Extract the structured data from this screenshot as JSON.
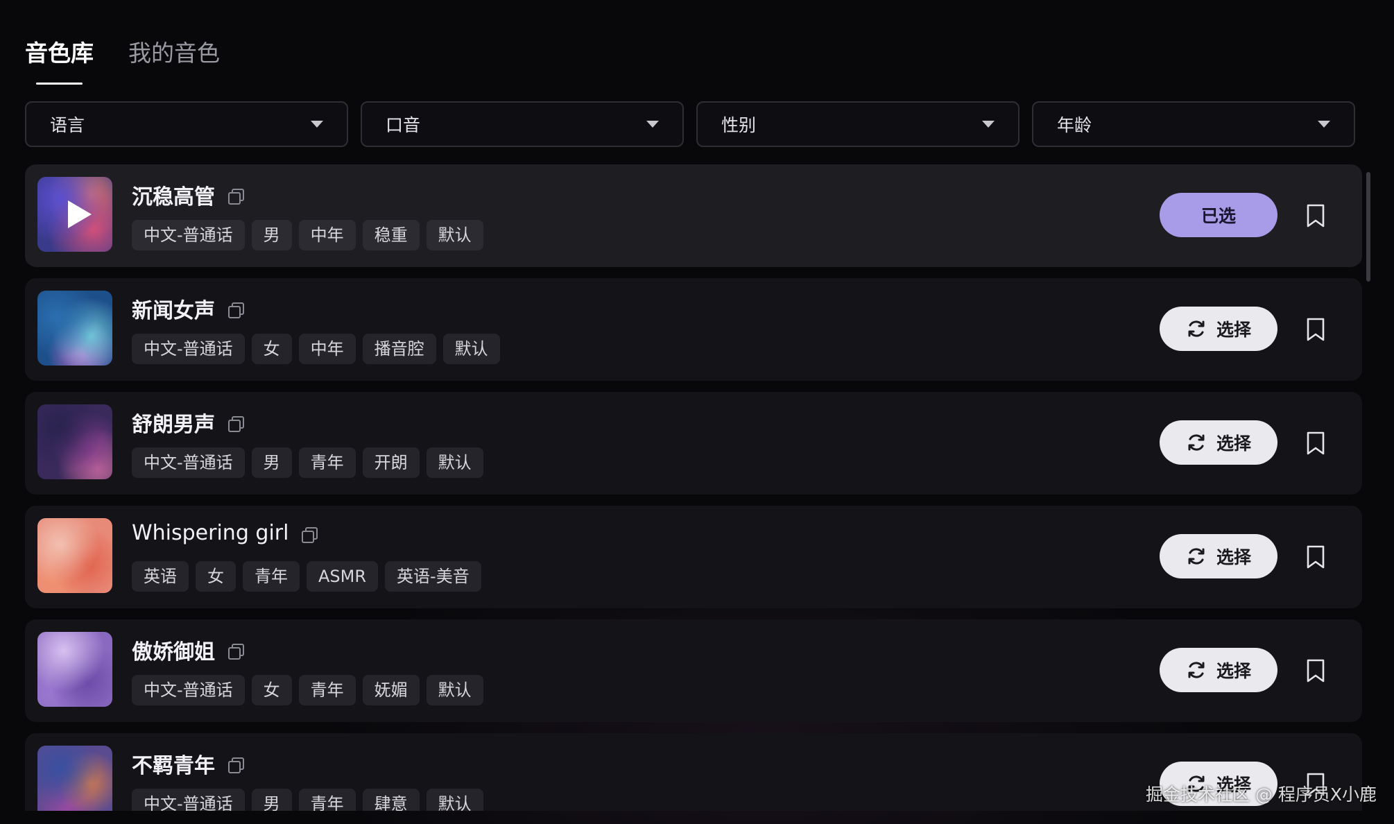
{
  "tabs": [
    {
      "label": "音色库",
      "active": true
    },
    {
      "label": "我的音色",
      "active": false
    }
  ],
  "filters": [
    {
      "label": "语言"
    },
    {
      "label": "口音"
    },
    {
      "label": "性别"
    },
    {
      "label": "年龄"
    }
  ],
  "voices": [
    {
      "name": "沉稳高管",
      "tags": [
        "中文-普通话",
        "男",
        "中年",
        "稳重",
        "默认"
      ],
      "action": "已选",
      "selected": true
    },
    {
      "name": "新闻女声",
      "tags": [
        "中文-普通话",
        "女",
        "中年",
        "播音腔",
        "默认"
      ],
      "action": "选择",
      "selected": false
    },
    {
      "name": "舒朗男声",
      "tags": [
        "中文-普通话",
        "男",
        "青年",
        "开朗",
        "默认"
      ],
      "action": "选择",
      "selected": false
    },
    {
      "name": "Whispering girl",
      "tags": [
        "英语",
        "女",
        "青年",
        "ASMR",
        "英语-美音"
      ],
      "action": "选择",
      "selected": false
    },
    {
      "name": "傲娇御姐",
      "tags": [
        "中文-普通话",
        "女",
        "青年",
        "妩媚",
        "默认"
      ],
      "action": "选择",
      "selected": false
    },
    {
      "name": "不羁青年",
      "tags": [
        "中文-普通话",
        "男",
        "青年",
        "肆意",
        "默认"
      ],
      "action": "选择",
      "selected": false
    }
  ],
  "watermark": "掘金技术社区 @ 程序员X小鹿",
  "colors": {
    "accent": "#a89be8",
    "background": "#08080b",
    "row": "#141418"
  }
}
